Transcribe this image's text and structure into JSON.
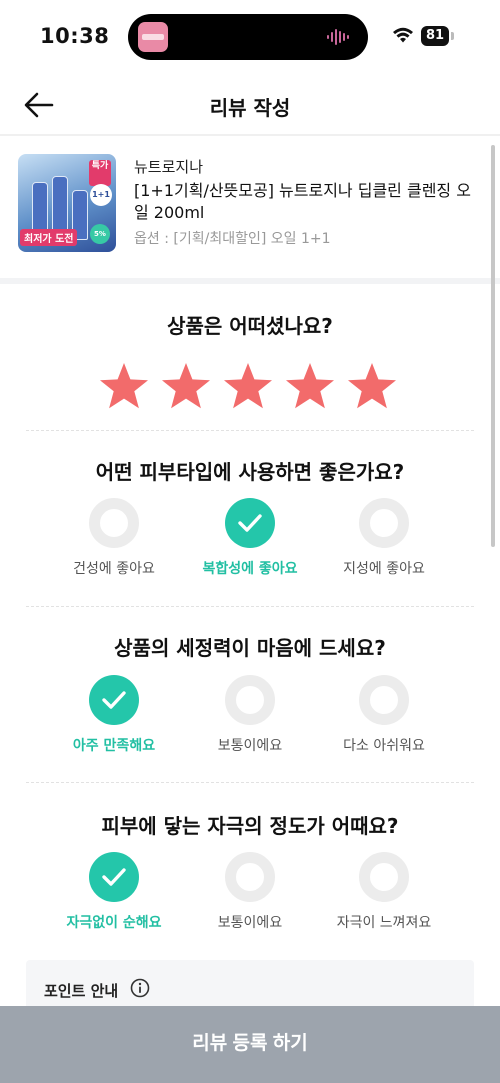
{
  "status_bar": {
    "time": "10:38",
    "battery": "81"
  },
  "header": {
    "title": "리뷰 작성"
  },
  "product": {
    "brand": "뉴트로지나",
    "name": "[1+1기획/산뜻모공] 뉴트로지나 딥클린 클렌징 오일 200ml",
    "option": "옵션 : [기획/최대할인] 오일 1+1",
    "thumb_badge": "1+1",
    "thumb_price": "최저가 도전",
    "thumb_pct": "5%"
  },
  "rating": {
    "question": "상품은 어떠셨나요?",
    "stars": 5,
    "star_color": "#f26b6b"
  },
  "skin_type": {
    "question": "어떤 피부타입에 사용하면 좋은가요?",
    "options": [
      "건성에 좋아요",
      "복합성에 좋아요",
      "지성에 좋아요"
    ],
    "selected": 1
  },
  "cleansing": {
    "question": "상품의 세정력이 마음에 드세요?",
    "options": [
      "아주 만족해요",
      "보통이에요",
      "다소 아쉬워요"
    ],
    "selected": 0
  },
  "irritation": {
    "question": "피부에 닿는 자극의 정도가 어때요?",
    "options": [
      "자극없이 순해요",
      "보통이에요",
      "자극이 느껴져요"
    ],
    "selected": 0
  },
  "points": {
    "title": "포인트 안내"
  },
  "submit": {
    "label": "리뷰 등록 하기"
  },
  "colors": {
    "accent": "#24c6aa",
    "star": "#f26b6b",
    "submit_bg": "#9da4ad"
  }
}
